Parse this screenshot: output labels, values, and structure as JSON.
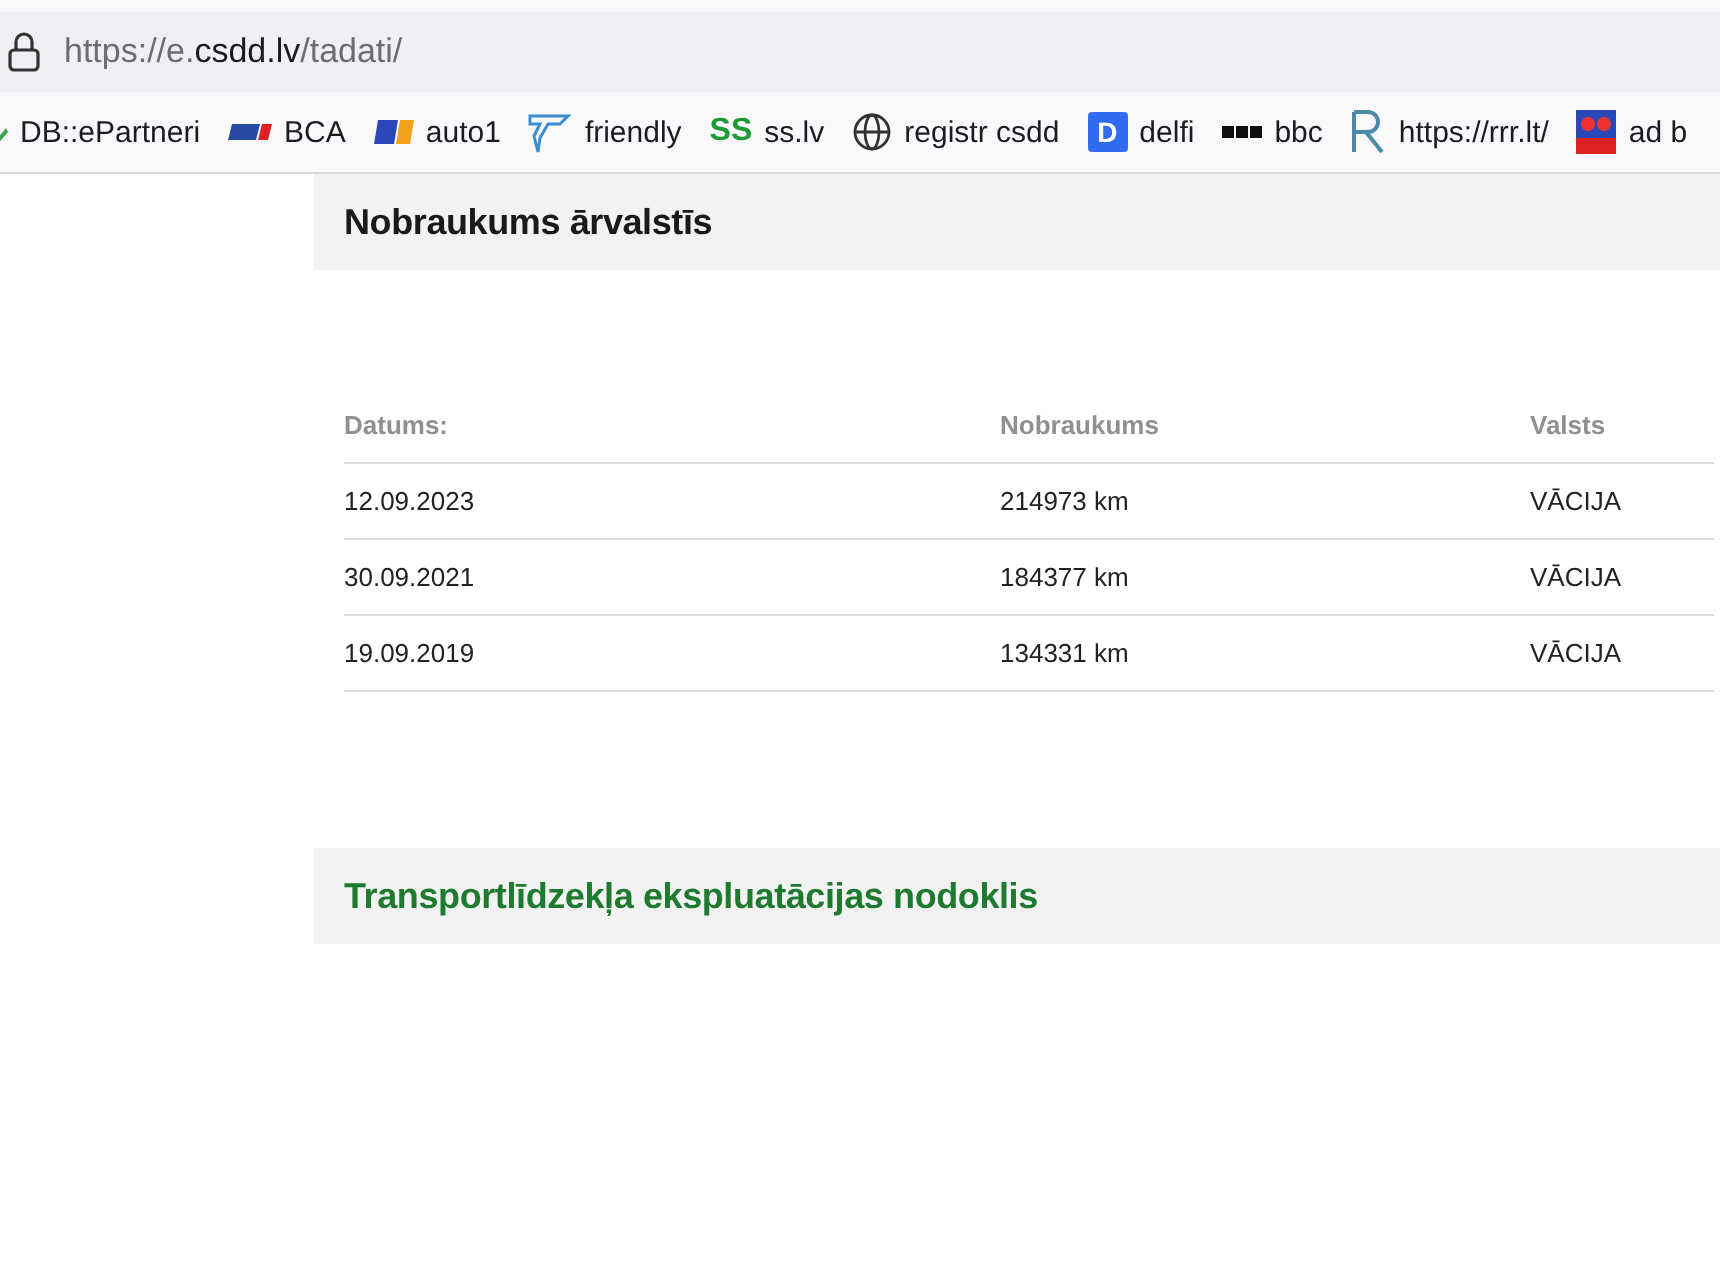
{
  "address_bar": {
    "url_start": "https://e.",
    "url_domain": "csdd.lv",
    "url_path": "/tadati/"
  },
  "bookmarks": [
    {
      "kind": "leaf",
      "label": "DB::ePartneri"
    },
    {
      "kind": "flag",
      "label": "BCA"
    },
    {
      "kind": "a1",
      "label": "auto1"
    },
    {
      "kind": "bird",
      "label": "friendly"
    },
    {
      "kind": "ss",
      "label": "ss.lv",
      "icon_text": "SS"
    },
    {
      "kind": "globe",
      "label": "registr csdd"
    },
    {
      "kind": "d",
      "label": "delfi",
      "icon_text": "D"
    },
    {
      "kind": "dots",
      "label": "bbc"
    },
    {
      "kind": "r",
      "label": "https://rrr.lt/"
    },
    {
      "kind": "ad",
      "label": "ad b"
    }
  ],
  "sections": [
    {
      "title": "Nobraukums ārvalstīs",
      "color": "#1a1a1a",
      "table": {
        "columns": [
          "Datums:",
          "Nobraukums",
          "Valsts"
        ],
        "rows": [
          [
            "12.09.2023",
            "214973 km",
            "VĀCIJA"
          ],
          [
            "30.09.2021",
            "184377 km",
            "VĀCIJA"
          ],
          [
            "19.09.2019",
            "134331 km",
            "VĀCIJA"
          ]
        ]
      }
    },
    {
      "title": "Transportlīdzekļa ekspluatācijas nodoklis",
      "color": "#1e7a2e"
    }
  ]
}
